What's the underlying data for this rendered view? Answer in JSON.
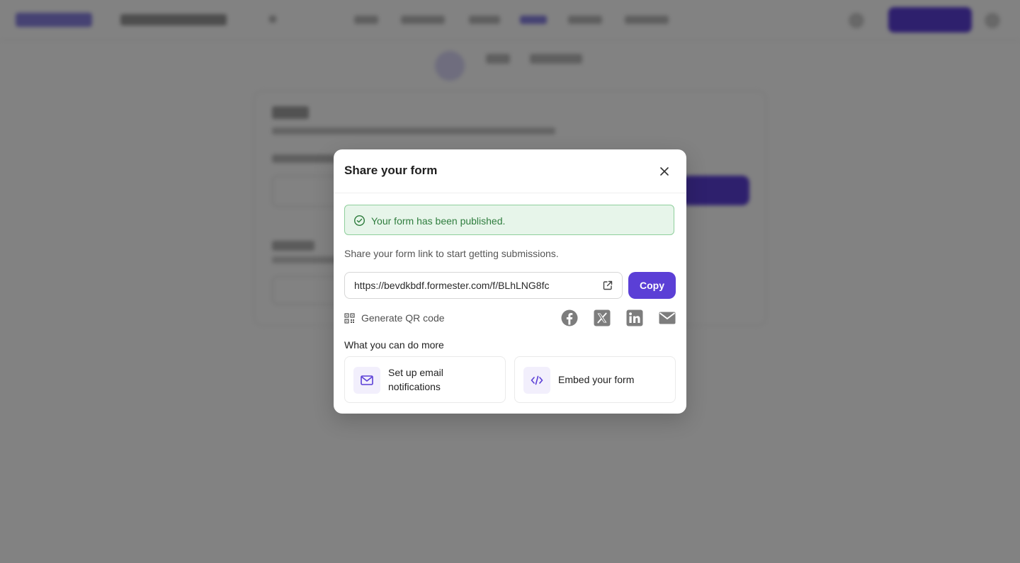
{
  "modal": {
    "title": "Share your form",
    "alert_text": "Your form has been published.",
    "hint": "Share your form link to start getting submissions.",
    "link_value": "https://bevdkbdf.formester.com/f/BLhLNG8fc",
    "copy_label": "Copy",
    "qr_label": "Generate QR code",
    "more_title": "What you can do more",
    "actions": [
      {
        "label_line1": "Set up email",
        "label_line2": "notifications",
        "icon": "mail-icon"
      },
      {
        "label": "Embed your form",
        "icon": "code-icon"
      }
    ],
    "share_icons": [
      "facebook-icon",
      "x-icon",
      "linkedin-icon",
      "email-icon"
    ]
  },
  "colors": {
    "accent": "#5b3fd6",
    "success_bg": "#e7f5ea",
    "success_border": "#8fcf9c",
    "success_text": "#2f7d3e",
    "overlay": "rgba(0,0,0,0.49)"
  }
}
